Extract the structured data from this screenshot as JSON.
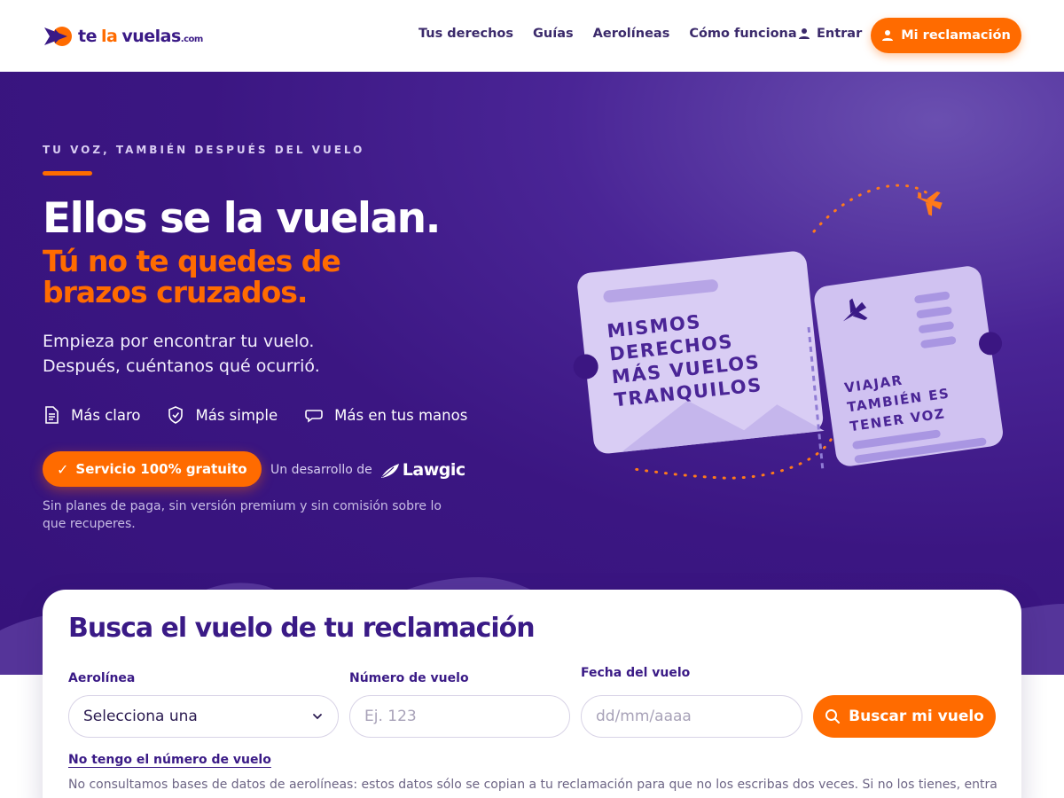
{
  "header": {
    "logo": {
      "part1": "te",
      "part2": "la",
      "part3": "vuelas",
      "domain": ".com"
    },
    "nav": [
      "Tus derechos",
      "Guías",
      "Aerolíneas",
      "Cómo funciona"
    ],
    "login_label": "Entrar",
    "claim_button": "Mi reclamación"
  },
  "hero": {
    "kicker": "TU VOZ, TAMBIÉN DESPUÉS DEL VUELO",
    "title": "Ellos se la vuelan.",
    "subtitle": "Tú no te quedes de brazos cruzados.",
    "lead_line1": "Empieza por encontrar tu vuelo.",
    "lead_line2": "Después, cuéntanos qué ocurrió.",
    "features": [
      {
        "icon": "document-icon",
        "label": "Más claro"
      },
      {
        "icon": "shield-check-icon",
        "label": "Más simple"
      },
      {
        "icon": "chat-bubble-icon",
        "label": "Más en tus manos"
      }
    ],
    "free_badge": "Servicio 100% gratuito",
    "developed_by": "Un desarrollo de",
    "developer_name": "Lawgic",
    "note": "Sin planes de paga, sin versión premium y sin comisión sobre lo que recuperes.",
    "ticket_left": [
      "MISMOS",
      "DERECHOS",
      "MÁS VUELOS",
      "TRANQUILOS"
    ],
    "ticket_right": [
      "VIAJAR",
      "TAMBIÉN ES",
      "TENER VOZ"
    ]
  },
  "search": {
    "title": "Busca el vuelo de tu reclamación",
    "airline_label": "Aerolínea",
    "airline_value": "Selecciona una",
    "flight_label": "Número de vuelo",
    "flight_placeholder": "Ej. 123",
    "date_label": "Fecha del vuelo",
    "date_placeholder": "dd/mm/aaaa",
    "button": "Buscar mi vuelo",
    "no_number_link": "No tengo el número de vuelo",
    "disclaimer": "No consultamos bases de datos de aerolíneas: estos datos sólo se copian a tu reclamación para que no los escribas dos veces. Si no los tienes, entra"
  },
  "colors": {
    "brand_orange": "#ff6b00",
    "brand_purple": "#3a1a86",
    "hero_bg": "#3b1682"
  }
}
